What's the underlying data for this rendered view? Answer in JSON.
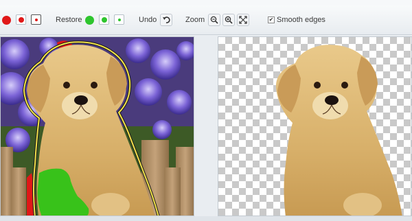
{
  "toolbar": {
    "restore_label": "Restore",
    "undo_label": "Undo",
    "zoom_label": "Zoom",
    "smooth_edges_label": "Smooth edges",
    "smooth_edges_checked": "✔"
  },
  "colors": {
    "remove_brush": "#e01818",
    "restore_brush": "#2ec52e",
    "left_outline": "#f2e24a",
    "restore_mark": "#38c21a"
  }
}
